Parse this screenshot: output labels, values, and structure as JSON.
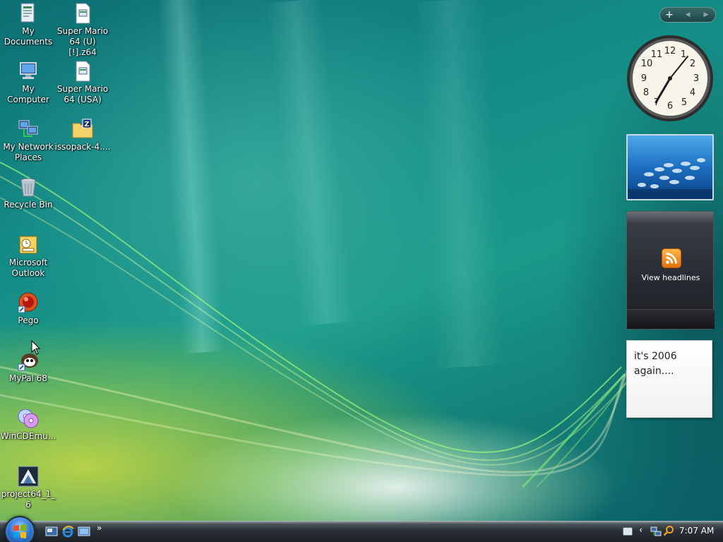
{
  "desktop": {
    "icons": [
      {
        "label": "My Documents",
        "icon": "my-documents-icon"
      },
      {
        "label": "Super Mario 64 (U) [!].z64",
        "icon": "file-icon"
      },
      {
        "label": "My Computer",
        "icon": "computer-icon"
      },
      {
        "label": "Super Mario 64 (USA)",
        "icon": "file-icon"
      },
      {
        "label": "My Network Places",
        "icon": "network-icon"
      },
      {
        "label": "issopack-4....",
        "icon": "zip-folder-icon"
      },
      {
        "label": "Recycle Bin",
        "icon": "recycle-bin-icon"
      },
      {
        "label": "Microsoft Outlook",
        "icon": "outlook-icon"
      },
      {
        "label": "Pego",
        "icon": "pego-icon"
      },
      {
        "label": "MyPal 68",
        "icon": "mypal-icon"
      },
      {
        "label": "WinCDEmu...",
        "icon": "wincdemu-icon"
      },
      {
        "label": "project64_1_6",
        "icon": "project64-icon"
      }
    ]
  },
  "sidebar": {
    "controls": {
      "add": "+",
      "prev": "◀",
      "next": "▶"
    },
    "clock": {
      "numbers": [
        "12",
        "1",
        "2",
        "3",
        "4",
        "5",
        "6",
        "7",
        "8",
        "9",
        "10",
        "11"
      ],
      "time": "7:07"
    },
    "slideshow": {
      "subject": "fish school underwater"
    },
    "feed": {
      "label": "View headlines"
    },
    "note": {
      "line1": "it's 2006",
      "line2": "again...."
    }
  },
  "taskbar": {
    "start_icon": "windows-orb-icon",
    "quick_launch_more": "»",
    "tray_arrow": "‹",
    "time": "7:07 AM"
  },
  "colors": {
    "taskbar": "#1b2024",
    "feed_bg": "#272a31",
    "rss_orange": "#f08a1c"
  }
}
